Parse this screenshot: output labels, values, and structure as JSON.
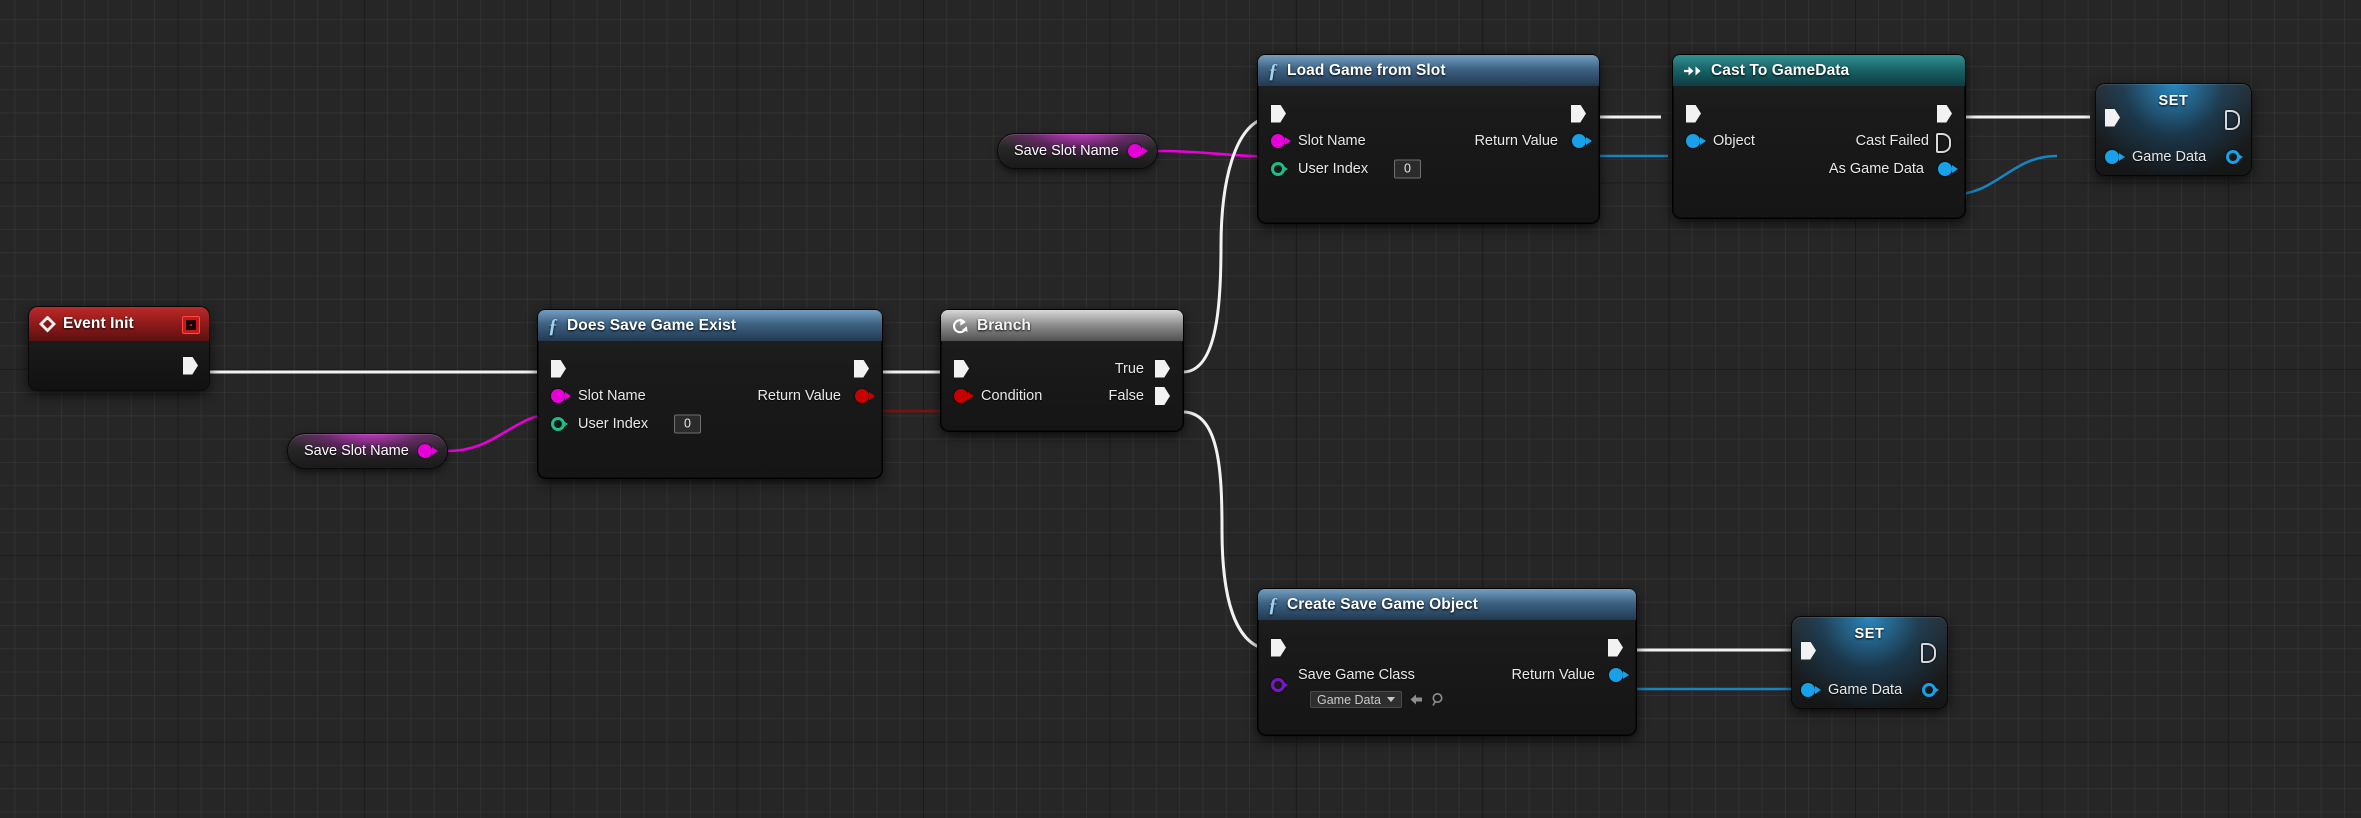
{
  "app": {
    "title": "Unreal Engine Blueprint Graph",
    "background_color": "#262626",
    "grid_line_color": "#333333"
  },
  "colors": {
    "exec_wire": "#f2f2f2",
    "name_pin": "#e800d8",
    "int_pin": "#1bbf84",
    "bool_pin": "#c70000",
    "object_pin": "#18a0e8",
    "class_pin": "#7a16c8",
    "function_header": "#3c6a92",
    "cast_header": "#168e92",
    "event_header": "#b42a28",
    "branch_header": "#9a9a9a"
  },
  "nodes": {
    "event_init": {
      "title": "Event Init",
      "icon": "event-diamond-icon",
      "output_exec": "exec-out"
    },
    "save_slot_name_bottom": {
      "label": "Save Slot Name",
      "pin_type": "name"
    },
    "save_slot_name_top": {
      "label": "Save Slot Name",
      "pin_type": "name"
    },
    "does_save_game_exist": {
      "title": "Does Save Game Exist",
      "icon": "function-icon",
      "inputs": [
        {
          "label": "Slot Name",
          "pin_type": "name"
        },
        {
          "label": "User Index",
          "pin_type": "int",
          "value": "0"
        }
      ],
      "outputs": [
        {
          "label": "Return Value",
          "pin_type": "bool"
        }
      ]
    },
    "branch": {
      "title": "Branch",
      "icon": "branch-icon",
      "inputs": [
        {
          "label": "Condition",
          "pin_type": "bool"
        }
      ],
      "outputs": [
        {
          "label": "True",
          "pin_type": "exec"
        },
        {
          "label": "False",
          "pin_type": "exec"
        }
      ]
    },
    "load_game_from_slot": {
      "title": "Load Game from Slot",
      "icon": "function-icon",
      "inputs": [
        {
          "label": "Slot Name",
          "pin_type": "name"
        },
        {
          "label": "User Index",
          "pin_type": "int",
          "value": "0"
        }
      ],
      "outputs": [
        {
          "label": "Return Value",
          "pin_type": "object"
        }
      ]
    },
    "cast_to_gamedata": {
      "title": "Cast To GameData",
      "icon": "cast-icon",
      "inputs": [
        {
          "label": "Object",
          "pin_type": "object"
        }
      ],
      "outputs": [
        {
          "label": "Cast Failed",
          "pin_type": "exec-hollow"
        },
        {
          "label": "As Game Data",
          "pin_type": "object"
        }
      ]
    },
    "set_game_data_top": {
      "title": "SET",
      "variable_label": "Game Data",
      "pin_type": "object"
    },
    "create_save_game_object": {
      "title": "Create Save Game Object",
      "icon": "function-icon",
      "inputs": [
        {
          "label": "Save Game Class",
          "pin_type": "class",
          "value": "Game Data",
          "browse_icon": "browse-arrow-icon",
          "search_icon": "magnifier-icon"
        }
      ],
      "outputs": [
        {
          "label": "Return Value",
          "pin_type": "object"
        }
      ]
    },
    "set_game_data_bottom": {
      "title": "SET",
      "variable_label": "Game Data",
      "pin_type": "object"
    }
  }
}
